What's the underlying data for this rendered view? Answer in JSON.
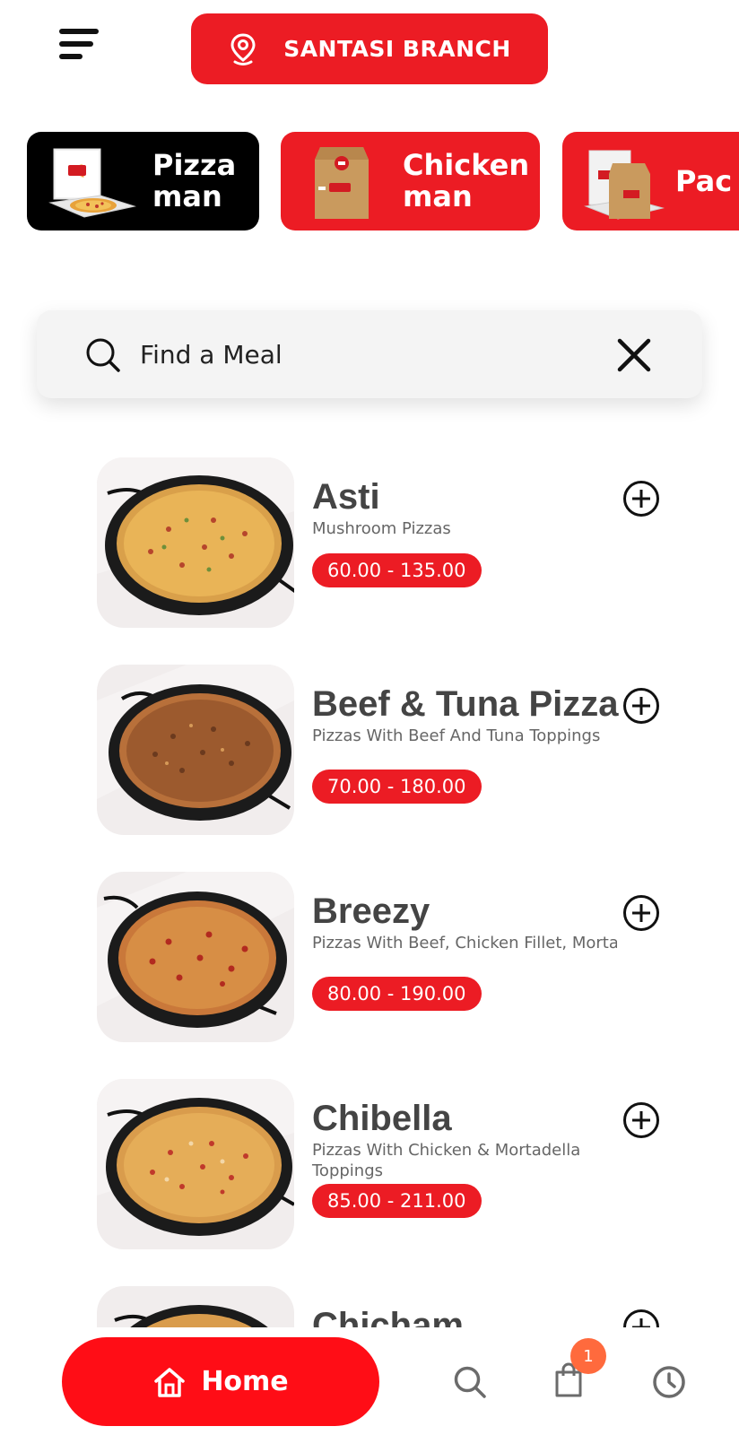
{
  "header": {
    "branch_label": "SANTASI BRANCH"
  },
  "categories": [
    {
      "label_line1": "Pizza",
      "label_line2": "man",
      "active": true
    },
    {
      "label_line1": "Chicken",
      "label_line2": "man",
      "active": false
    },
    {
      "label_line1": "Pac",
      "label_line2": "",
      "active": false
    }
  ],
  "search": {
    "placeholder": "Find a Meal",
    "value": ""
  },
  "menu_items": [
    {
      "name": "Asti",
      "description": "Mushroom  Pizzas",
      "price": "60.00 - 135.00"
    },
    {
      "name": "Beef & Tuna Pizza",
      "description": "Pizzas With Beef And Tuna Toppings",
      "price": "70.00 - 180.00"
    },
    {
      "name": "Breezy",
      "description": "Pizzas With Beef, Chicken Fillet, Mortadella, Ham, Pepperoni And...",
      "price": "80.00 - 190.00"
    },
    {
      "name": "Chibella",
      "description": "Pizzas With Chicken & Mortadella Toppings",
      "price": "85.00 - 211.00"
    },
    {
      "name": "Chicham",
      "description": "",
      "price": ""
    }
  ],
  "bottom_nav": {
    "home_label": "Home",
    "cart_badge": "1",
    "icons": [
      "home-icon",
      "search-icon",
      "shopping-bag-icon",
      "clock-icon"
    ]
  },
  "colors": {
    "brand_red": "#ec1c24",
    "badge_orange": "#ff6a3d",
    "active_category": "#000000"
  }
}
